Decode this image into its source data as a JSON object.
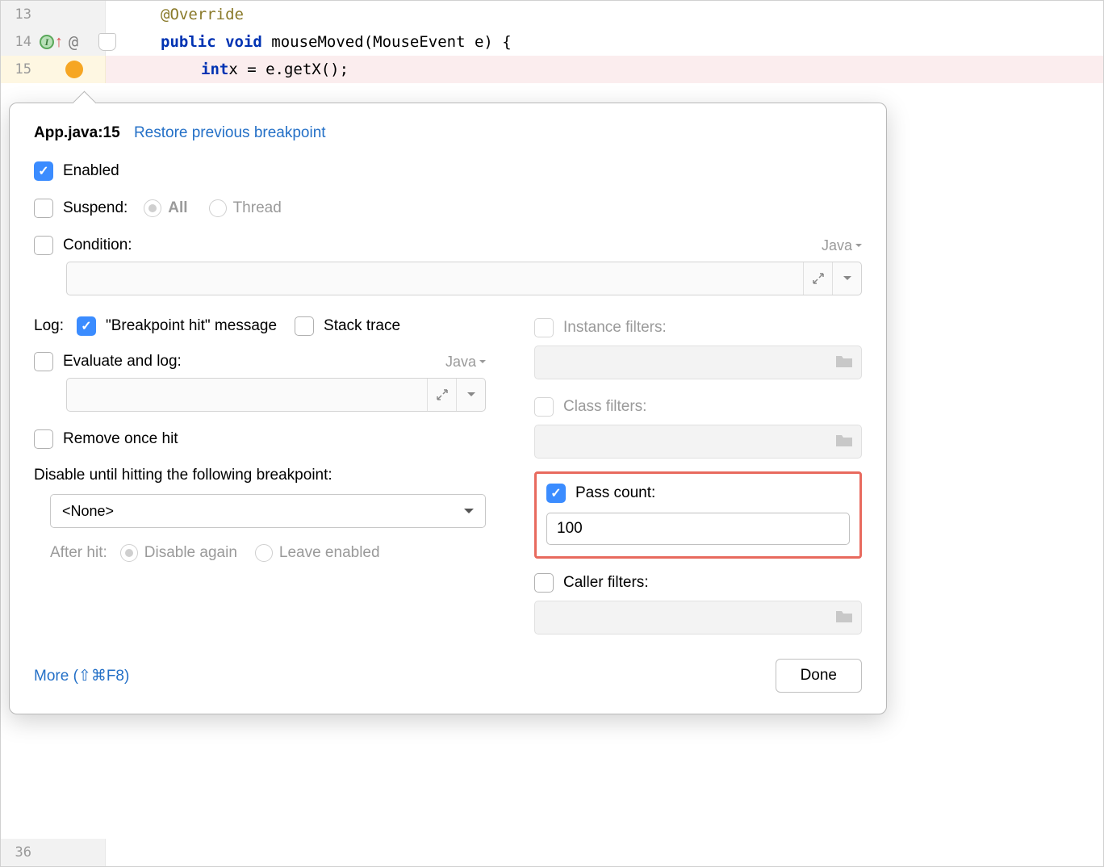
{
  "code": {
    "lines": [
      {
        "num": "13",
        "html": "<span class='tok-anno'>@Override</span>"
      },
      {
        "num": "14",
        "html": "<span class='tok-kw'>public void</span> <span class='tok-method'>mouseMoved</span><span class='tok-paren'>(MouseEvent e) {</span>"
      },
      {
        "num": "15",
        "html": "<span class='tok-kw'>int</span> <span class='tok-id'>x = e.getX();</span>"
      }
    ],
    "trailing_line": "36"
  },
  "popup": {
    "title_file": "App.java:15",
    "title_link": "Restore previous breakpoint",
    "enabled_label": "Enabled",
    "suspend_label": "Suspend:",
    "suspend_all": "All",
    "suspend_thread": "Thread",
    "condition_label": "Condition:",
    "java_lang": "Java",
    "log_label": "Log:",
    "log_bp_hit": "\"Breakpoint hit\" message",
    "log_stack": "Stack trace",
    "eval_label": "Evaluate and log:",
    "remove_once": "Remove once hit",
    "disable_until": "Disable until hitting the following breakpoint:",
    "disable_select": "<None>",
    "after_hit": "After hit:",
    "after_disable": "Disable again",
    "after_leave": "Leave enabled",
    "instance_filters": "Instance filters:",
    "class_filters": "Class filters:",
    "pass_count_label": "Pass count:",
    "pass_count_value": "100",
    "caller_filters": "Caller filters:",
    "more": "More (⇧⌘F8)",
    "done": "Done"
  }
}
